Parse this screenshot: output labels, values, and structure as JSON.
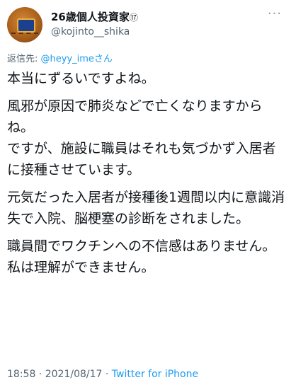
{
  "author": {
    "display_name": "26歳個人投資家",
    "name_suffix": "⑰",
    "username": "@kojinto__shika"
  },
  "menu": {
    "icon": "more-horizontal-icon",
    "glyph": "···"
  },
  "reply": {
    "prefix": "返信先: ",
    "mention": "@heyy_ime",
    "suffix": "さん"
  },
  "tweet": {
    "paragraphs": [
      "本当にずるいですよね。",
      "風邪が原因で肺炎などで亡くなりますからね。\nですが、施設に職員はそれも気づかず入居者に接種させています。",
      "元気だった入居者が接種後1週間以内に意識消失で入院、脳梗塞の診断をされました。",
      "職員間でワクチンへの不信感はありません。\n私は理解ができません。"
    ]
  },
  "meta": {
    "time": "18:58",
    "separator1": " · ",
    "date": "2021/08/17",
    "separator2": " · ",
    "source": "Twitter for iPhone"
  },
  "colors": {
    "text": "#0f1419",
    "secondary": "#536471",
    "link": "#1d9bf0"
  }
}
